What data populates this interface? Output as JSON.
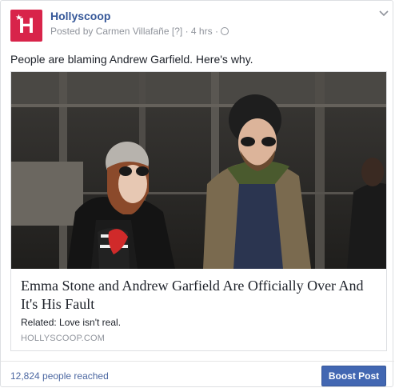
{
  "colors": {
    "brand": "#d8244a",
    "link": "#365899",
    "button": "#4267b2"
  },
  "post": {
    "page_name": "Hollyscoop",
    "posted_by": "Posted by Carmen Villafañe",
    "help_marker": "[?]",
    "timestamp": "4 hrs",
    "separator": "·",
    "privacy_icon": "globe-icon",
    "text": "People are blaming Andrew Garfield. Here's why."
  },
  "avatar": {
    "letter": "H",
    "star": "★"
  },
  "link": {
    "title": "Emma Stone and Andrew Garfield Are Officially Over And It's His Fault",
    "description": "Related: Love isn't real.",
    "domain": "HOLLYSCOOP.COM"
  },
  "footer": {
    "reach": "12,824 people reached",
    "boost_label": "Boost Post"
  }
}
